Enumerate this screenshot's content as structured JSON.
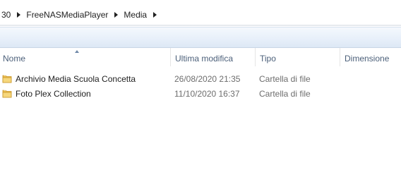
{
  "breadcrumb": {
    "items": [
      "30",
      "FreeNASMediaPlayer",
      "Media"
    ]
  },
  "columns": {
    "name": "Nome",
    "modified": "Ultima modifica",
    "type": "Tipo",
    "size": "Dimensione"
  },
  "files": [
    {
      "name": "Archivio Media Scuola Concetta",
      "modified": "26/08/2020 21:35",
      "type": "Cartella di file",
      "icon": "folder-icon"
    },
    {
      "name": "Foto Plex Collection",
      "modified": "11/10/2020 16:37",
      "type": "Cartella di file",
      "icon": "folder-icon"
    }
  ],
  "colors": {
    "folder": "#e8b94a",
    "header_text": "#4c607a",
    "toolbar": "#e8f0fa"
  }
}
